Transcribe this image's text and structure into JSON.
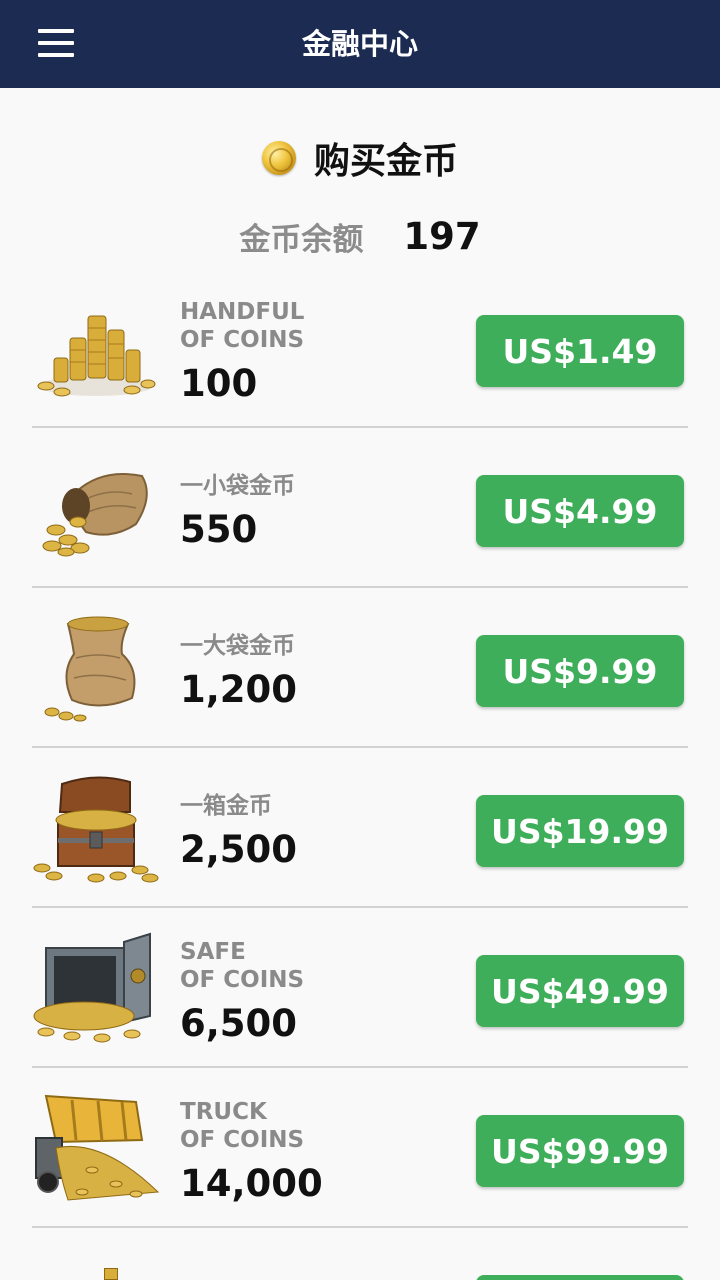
{
  "appbar": {
    "title": "金融中心",
    "menu_icon": "hamburger-menu-icon"
  },
  "header": {
    "title": "购买金币",
    "icon": "gold-coin-icon"
  },
  "balance": {
    "label": "金币余额",
    "value": "197"
  },
  "colors": {
    "appbar": "#1c2b52",
    "button": "#3fae5a",
    "divider": "#d3d3d3"
  },
  "packages": [
    {
      "name": "HANDFUL\nOF COINS",
      "amount": "100",
      "price": "US$1.49",
      "image": "coin-stacks-image"
    },
    {
      "name": "一小袋金币",
      "amount": "550",
      "price": "US$4.99",
      "image": "small-coin-sack-image"
    },
    {
      "name": "一大袋金币",
      "amount": "1,200",
      "price": "US$9.99",
      "image": "large-coin-sack-image"
    },
    {
      "name": "一箱金币",
      "amount": "2,500",
      "price": "US$19.99",
      "image": "treasure-chest-image"
    },
    {
      "name": "SAFE\nOF COINS",
      "amount": "6,500",
      "price": "US$49.99",
      "image": "coin-safe-image"
    },
    {
      "name": "TRUCK\nOF COINS",
      "amount": "14,000",
      "price": "US$99.99",
      "image": "coin-truck-image"
    }
  ]
}
